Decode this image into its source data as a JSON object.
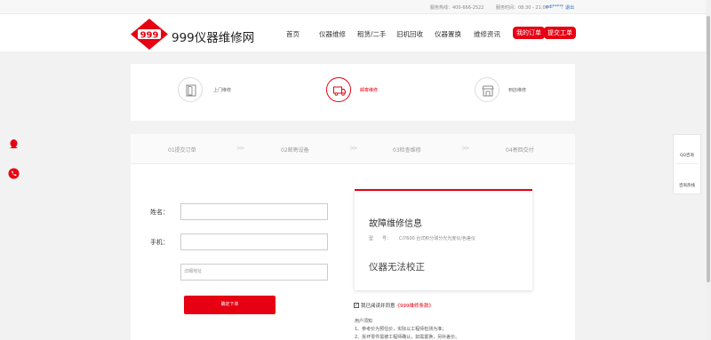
{
  "topbar": {
    "hotline": "服务热线：400-666-2522",
    "hours": "服务时间：08:30 - 21:00",
    "user": "edi*****",
    "separator": "|",
    "logout": "退出"
  },
  "header": {
    "logo_mark_text": "999",
    "logo_text": "999仪器维修网",
    "nav": [
      "首页",
      "仪器维修",
      "租赁/二手",
      "旧机回收",
      "仪器置换",
      "维修资讯"
    ],
    "my_orders": "我的订单",
    "submit_ticket": "提交工单"
  },
  "services": [
    {
      "label": "上门维修",
      "icon": "door-icon",
      "active": false
    },
    {
      "label": "邮寄维修",
      "icon": "truck-icon",
      "active": true
    },
    {
      "label": "到店维修",
      "icon": "shop-icon",
      "active": false
    }
  ],
  "steps": [
    "01提交订单",
    "02邮寄设备",
    "03检查维修",
    "04寄回交付"
  ],
  "step_arrow": ">>",
  "form": {
    "name_label": "姓名：",
    "name_value": "",
    "phone_label": "手机：",
    "phone_value": "",
    "address_placeholder": "详细地址",
    "submit_label": "确定下单"
  },
  "fault": {
    "title": "故障维修信息",
    "model_label": "型　　号：",
    "model_value": "CI7600 台式积分球分光光度仪/色差仪",
    "description": "仪器无法校正"
  },
  "agreement": {
    "checked": true,
    "text": "我已阅读并同意",
    "link": "《999维修条款》"
  },
  "notice": {
    "title": "用户须知",
    "items": [
      "1、参考价为预估价，实际以工程师检测为准；",
      "2、拆坏零件需被工程师确认，如需置换，另补差价。"
    ]
  },
  "sidebar": {
    "qq": "QQ咨询",
    "phone": "咨询热线"
  },
  "colors": {
    "accent": "#e60012",
    "link": "#2b6cc4"
  }
}
